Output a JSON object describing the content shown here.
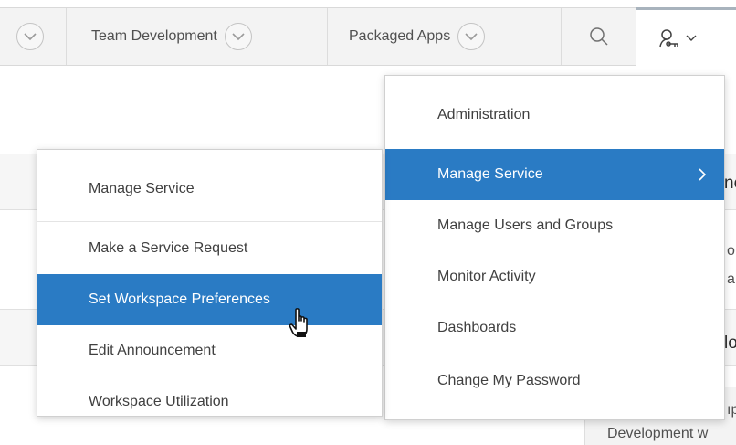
{
  "nav": {
    "tabs": [
      {
        "label": ""
      },
      {
        "label": "Team Development"
      },
      {
        "label": "Packaged Apps"
      }
    ],
    "search_icon": "search-icon",
    "user_icon": "user-key-icon"
  },
  "background": {
    "fragments": [
      "ne",
      "o",
      "a",
      "lo",
      "ıp",
      "Development w"
    ]
  },
  "main_menu": {
    "items": [
      {
        "label": "Administration"
      },
      {
        "label": "Manage Service",
        "active": true,
        "has_submenu": true
      },
      {
        "label": "Manage Users and Groups"
      },
      {
        "label": "Monitor Activity"
      },
      {
        "label": "Dashboards"
      },
      {
        "label": "Change My Password"
      }
    ]
  },
  "sub_menu": {
    "items": [
      {
        "label": "Manage Service"
      },
      {
        "label": "Make a Service Request"
      },
      {
        "label": "Set Workspace Preferences",
        "active": true
      },
      {
        "label": "Edit Announcement"
      },
      {
        "label": "Workspace Utilization"
      }
    ]
  },
  "colors": {
    "accent": "#2a7bc4",
    "bar_bg": "#f3f3f3",
    "text": "#404040"
  }
}
